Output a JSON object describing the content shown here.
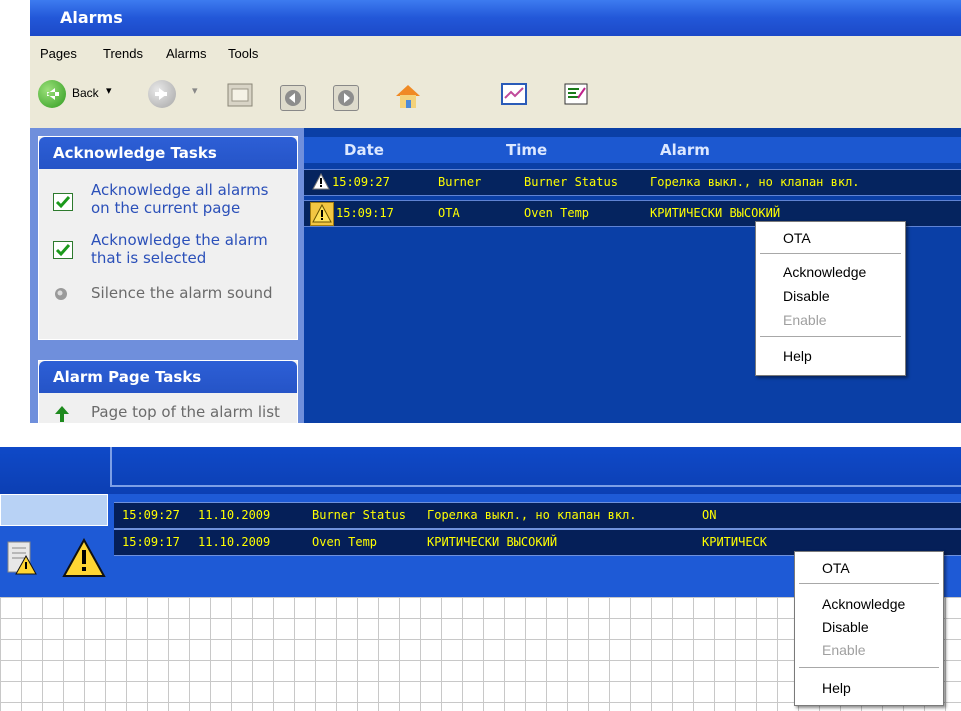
{
  "window": {
    "title": "Alarms"
  },
  "menu": [
    "Pages",
    "Trends",
    "Alarms",
    "Tools"
  ],
  "toolbar": {
    "back_label": "Back"
  },
  "tasks": {
    "acknowledge_title": "Acknowledge Tasks",
    "acknowledge_items": [
      {
        "line1": "Acknowledge all alarms",
        "line2": "on the current page"
      },
      {
        "line1": "Acknowledge the alarm",
        "line2": "that is selected"
      },
      {
        "line1": "Silence the alarm sound",
        "line2": ""
      }
    ],
    "page_title": "Alarm Page Tasks",
    "page_items": [
      "Page top of the alarm list"
    ]
  },
  "alarm_table": {
    "headers": {
      "date": "Date",
      "time": "Time",
      "alarm": "Alarm"
    },
    "rows": [
      {
        "time": "15:09:27",
        "tag": "Burner",
        "name": "Burner Status",
        "description": "Горелка выкл., но клапан вкл."
      },
      {
        "time": "15:09:17",
        "tag": "OTA",
        "name": "Oven Temp",
        "description": "КРИТИЧЕСКИ ВЫСОКИЙ"
      }
    ]
  },
  "context_menu": {
    "header": "OTA",
    "acknowledge": "Acknowledge",
    "disable": "Disable",
    "enable": "Enable",
    "help": "Help"
  },
  "banner_rows": [
    {
      "time": "15:09:27",
      "date": "11.10.2009",
      "name": "Burner Status",
      "description": "Горелка выкл., но клапан вкл.",
      "state": "ON"
    },
    {
      "time": "15:09:17",
      "date": "11.10.2009",
      "name": "Oven Temp",
      "description": "КРИТИЧЕСКИ ВЫСОКИЙ",
      "state": "КРИТИЧЕСК"
    }
  ],
  "colors": {
    "alarm_text": "#ffff00",
    "list_bg": "#0a3fa6",
    "title_blue": "#2257d8"
  },
  "icons": [
    "back-arrow-icon",
    "forward-arrow-icon",
    "folder-icon",
    "left-arrow-icon",
    "right-arrow-icon",
    "home-icon",
    "chart-icon",
    "report-icon",
    "check-icon",
    "speaker-icon",
    "up-arrow-icon",
    "warning-icon"
  ]
}
